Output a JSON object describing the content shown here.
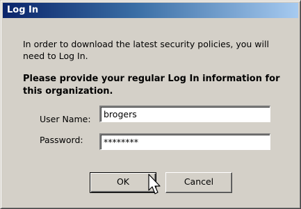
{
  "window": {
    "title": "Log In"
  },
  "message": {
    "info": "In order to download the latest security policies, you will need to Log In.",
    "instruction": "Please provide your regular Log In information for this organization."
  },
  "form": {
    "username_label": "User Name:",
    "username_value": "brogers",
    "password_label": "Password:",
    "password_value": "********"
  },
  "buttons": {
    "ok_label": "OK",
    "cancel_label": "Cancel"
  },
  "pointer": {
    "icon": "arrow-cursor-icon"
  }
}
